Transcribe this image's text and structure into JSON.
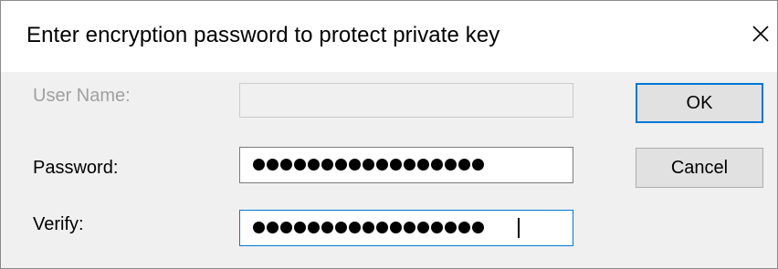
{
  "dialog": {
    "title": "Enter encryption password to protect private key"
  },
  "form": {
    "username_label": "User Name:",
    "username_value": "",
    "password_label": "Password:",
    "password_mask_length": 17,
    "verify_label": "Verify:",
    "verify_mask_length": 17
  },
  "buttons": {
    "ok_label": "OK",
    "cancel_label": "Cancel"
  },
  "icons": {
    "close": "close-icon"
  },
  "colors": {
    "focus_accent": "#0078d7",
    "disabled_text": "#a0a0a0",
    "dialog_body": "#f0f0f0"
  }
}
